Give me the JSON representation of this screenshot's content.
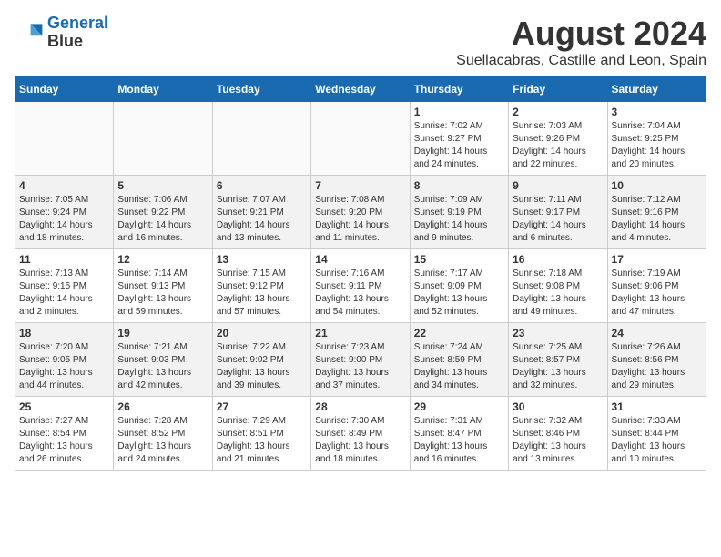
{
  "header": {
    "logo_line1": "General",
    "logo_line2": "Blue",
    "month": "August 2024",
    "location": "Suellacabras, Castille and Leon, Spain"
  },
  "weekdays": [
    "Sunday",
    "Monday",
    "Tuesday",
    "Wednesday",
    "Thursday",
    "Friday",
    "Saturday"
  ],
  "weeks": [
    [
      {
        "day": "",
        "info": ""
      },
      {
        "day": "",
        "info": ""
      },
      {
        "day": "",
        "info": ""
      },
      {
        "day": "",
        "info": ""
      },
      {
        "day": "1",
        "info": "Sunrise: 7:02 AM\nSunset: 9:27 PM\nDaylight: 14 hours\nand 24 minutes."
      },
      {
        "day": "2",
        "info": "Sunrise: 7:03 AM\nSunset: 9:26 PM\nDaylight: 14 hours\nand 22 minutes."
      },
      {
        "day": "3",
        "info": "Sunrise: 7:04 AM\nSunset: 9:25 PM\nDaylight: 14 hours\nand 20 minutes."
      }
    ],
    [
      {
        "day": "4",
        "info": "Sunrise: 7:05 AM\nSunset: 9:24 PM\nDaylight: 14 hours\nand 18 minutes."
      },
      {
        "day": "5",
        "info": "Sunrise: 7:06 AM\nSunset: 9:22 PM\nDaylight: 14 hours\nand 16 minutes."
      },
      {
        "day": "6",
        "info": "Sunrise: 7:07 AM\nSunset: 9:21 PM\nDaylight: 14 hours\nand 13 minutes."
      },
      {
        "day": "7",
        "info": "Sunrise: 7:08 AM\nSunset: 9:20 PM\nDaylight: 14 hours\nand 11 minutes."
      },
      {
        "day": "8",
        "info": "Sunrise: 7:09 AM\nSunset: 9:19 PM\nDaylight: 14 hours\nand 9 minutes."
      },
      {
        "day": "9",
        "info": "Sunrise: 7:11 AM\nSunset: 9:17 PM\nDaylight: 14 hours\nand 6 minutes."
      },
      {
        "day": "10",
        "info": "Sunrise: 7:12 AM\nSunset: 9:16 PM\nDaylight: 14 hours\nand 4 minutes."
      }
    ],
    [
      {
        "day": "11",
        "info": "Sunrise: 7:13 AM\nSunset: 9:15 PM\nDaylight: 14 hours\nand 2 minutes."
      },
      {
        "day": "12",
        "info": "Sunrise: 7:14 AM\nSunset: 9:13 PM\nDaylight: 13 hours\nand 59 minutes."
      },
      {
        "day": "13",
        "info": "Sunrise: 7:15 AM\nSunset: 9:12 PM\nDaylight: 13 hours\nand 57 minutes."
      },
      {
        "day": "14",
        "info": "Sunrise: 7:16 AM\nSunset: 9:11 PM\nDaylight: 13 hours\nand 54 minutes."
      },
      {
        "day": "15",
        "info": "Sunrise: 7:17 AM\nSunset: 9:09 PM\nDaylight: 13 hours\nand 52 minutes."
      },
      {
        "day": "16",
        "info": "Sunrise: 7:18 AM\nSunset: 9:08 PM\nDaylight: 13 hours\nand 49 minutes."
      },
      {
        "day": "17",
        "info": "Sunrise: 7:19 AM\nSunset: 9:06 PM\nDaylight: 13 hours\nand 47 minutes."
      }
    ],
    [
      {
        "day": "18",
        "info": "Sunrise: 7:20 AM\nSunset: 9:05 PM\nDaylight: 13 hours\nand 44 minutes."
      },
      {
        "day": "19",
        "info": "Sunrise: 7:21 AM\nSunset: 9:03 PM\nDaylight: 13 hours\nand 42 minutes."
      },
      {
        "day": "20",
        "info": "Sunrise: 7:22 AM\nSunset: 9:02 PM\nDaylight: 13 hours\nand 39 minutes."
      },
      {
        "day": "21",
        "info": "Sunrise: 7:23 AM\nSunset: 9:00 PM\nDaylight: 13 hours\nand 37 minutes."
      },
      {
        "day": "22",
        "info": "Sunrise: 7:24 AM\nSunset: 8:59 PM\nDaylight: 13 hours\nand 34 minutes."
      },
      {
        "day": "23",
        "info": "Sunrise: 7:25 AM\nSunset: 8:57 PM\nDaylight: 13 hours\nand 32 minutes."
      },
      {
        "day": "24",
        "info": "Sunrise: 7:26 AM\nSunset: 8:56 PM\nDaylight: 13 hours\nand 29 minutes."
      }
    ],
    [
      {
        "day": "25",
        "info": "Sunrise: 7:27 AM\nSunset: 8:54 PM\nDaylight: 13 hours\nand 26 minutes."
      },
      {
        "day": "26",
        "info": "Sunrise: 7:28 AM\nSunset: 8:52 PM\nDaylight: 13 hours\nand 24 minutes."
      },
      {
        "day": "27",
        "info": "Sunrise: 7:29 AM\nSunset: 8:51 PM\nDaylight: 13 hours\nand 21 minutes."
      },
      {
        "day": "28",
        "info": "Sunrise: 7:30 AM\nSunset: 8:49 PM\nDaylight: 13 hours\nand 18 minutes."
      },
      {
        "day": "29",
        "info": "Sunrise: 7:31 AM\nSunset: 8:47 PM\nDaylight: 13 hours\nand 16 minutes."
      },
      {
        "day": "30",
        "info": "Sunrise: 7:32 AM\nSunset: 8:46 PM\nDaylight: 13 hours\nand 13 minutes."
      },
      {
        "day": "31",
        "info": "Sunrise: 7:33 AM\nSunset: 8:44 PM\nDaylight: 13 hours\nand 10 minutes."
      }
    ]
  ]
}
